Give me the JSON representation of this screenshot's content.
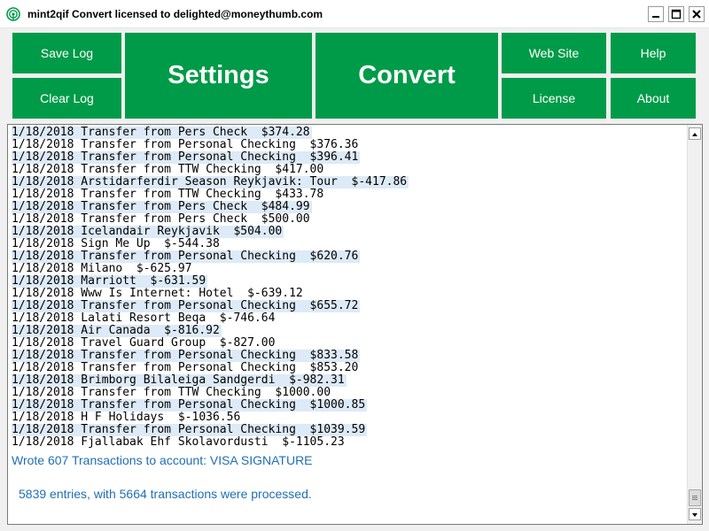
{
  "window": {
    "title": "mint2qif Convert licensed to delighted@moneythumb.com"
  },
  "toolbar": {
    "save_log": "Save Log",
    "clear_log": "Clear Log",
    "settings": "Settings",
    "convert": "Convert",
    "web_site": "Web Site",
    "help": "Help",
    "license": "License",
    "about": "About"
  },
  "colors": {
    "button_green": "#009b48",
    "status_blue": "#1f6fb4",
    "highlight": "#ddeaf7"
  },
  "log": {
    "lines": [
      "1/18/2018 Transfer from Pers Check  $374.28",
      "1/18/2018 Transfer from Personal Checking  $376.36",
      "1/18/2018 Transfer from Personal Checking  $396.41",
      "1/18/2018 Transfer from TTW Checking  $417.00",
      "1/18/2018 Arstidarferdir Season Reykjavik: Tour  $-417.86",
      "1/18/2018 Transfer from TTW Checking  $433.78",
      "1/18/2018 Transfer from Pers Check  $484.99",
      "1/18/2018 Transfer from Pers Check  $500.00",
      "1/18/2018 Icelandair Reykjavik  $504.00",
      "1/18/2018 Sign Me Up  $-544.38",
      "1/18/2018 Transfer from Personal Checking  $620.76",
      "1/18/2018 Milano  $-625.97",
      "1/18/2018 Marriott  $-631.59",
      "1/18/2018 Www Is Internet: Hotel  $-639.12",
      "1/18/2018 Transfer from Personal Checking  $655.72",
      "1/18/2018 Lalati Resort Beqa  $-746.64",
      "1/18/2018 Air Canada  $-816.92",
      "1/18/2018 Travel Guard Group  $-827.00",
      "1/18/2018 Transfer from Personal Checking  $833.58",
      "1/18/2018 Transfer from Personal Checking  $853.20",
      "1/18/2018 Brimborg Bilaleiga Sandgerdi  $-982.31",
      "1/18/2018 Transfer from TTW Checking  $1000.00",
      "1/18/2018 Transfer from Personal Checking  $1000.85",
      "1/18/2018 H F Holidays  $-1036.56",
      "1/18/2018 Transfer from Personal Checking  $1039.59",
      "1/18/2018 Fjallabak Ehf Skolavordusti  $-1105.23"
    ],
    "status_wrote": "Wrote 607 Transactions to account: VISA SIGNATURE",
    "status_entries": "5839 entries, with 5664 transactions were processed."
  }
}
